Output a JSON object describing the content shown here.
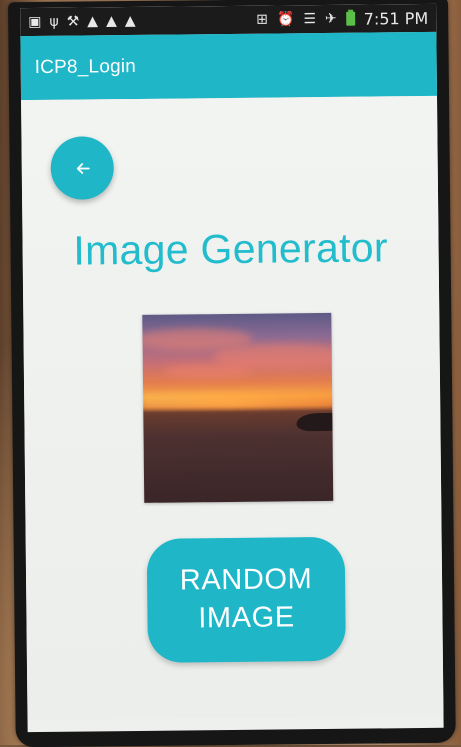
{
  "status_bar": {
    "left_icons": [
      "gallery-icon",
      "usb-icon",
      "wrench-icon",
      "warning-icon",
      "warning-icon",
      "warning-icon"
    ],
    "right_icons": [
      "nfc-icon",
      "alarm-icon",
      "wifi-icon",
      "airplane-icon",
      "battery-icon"
    ],
    "time": "7:51 PM"
  },
  "app_bar": {
    "title": "ICP8_Login"
  },
  "main": {
    "back_button_icon": "arrow-left-icon",
    "heading": "Image Generator",
    "image": "sunset-over-sea",
    "random_button": {
      "line1": "RANDOM",
      "line2": "IMAGE"
    }
  },
  "colors": {
    "accent": "#1fb6c8",
    "heading": "#22bccd",
    "status_bar": "#1b1b1b",
    "screen_bg": "#eef0ed"
  }
}
